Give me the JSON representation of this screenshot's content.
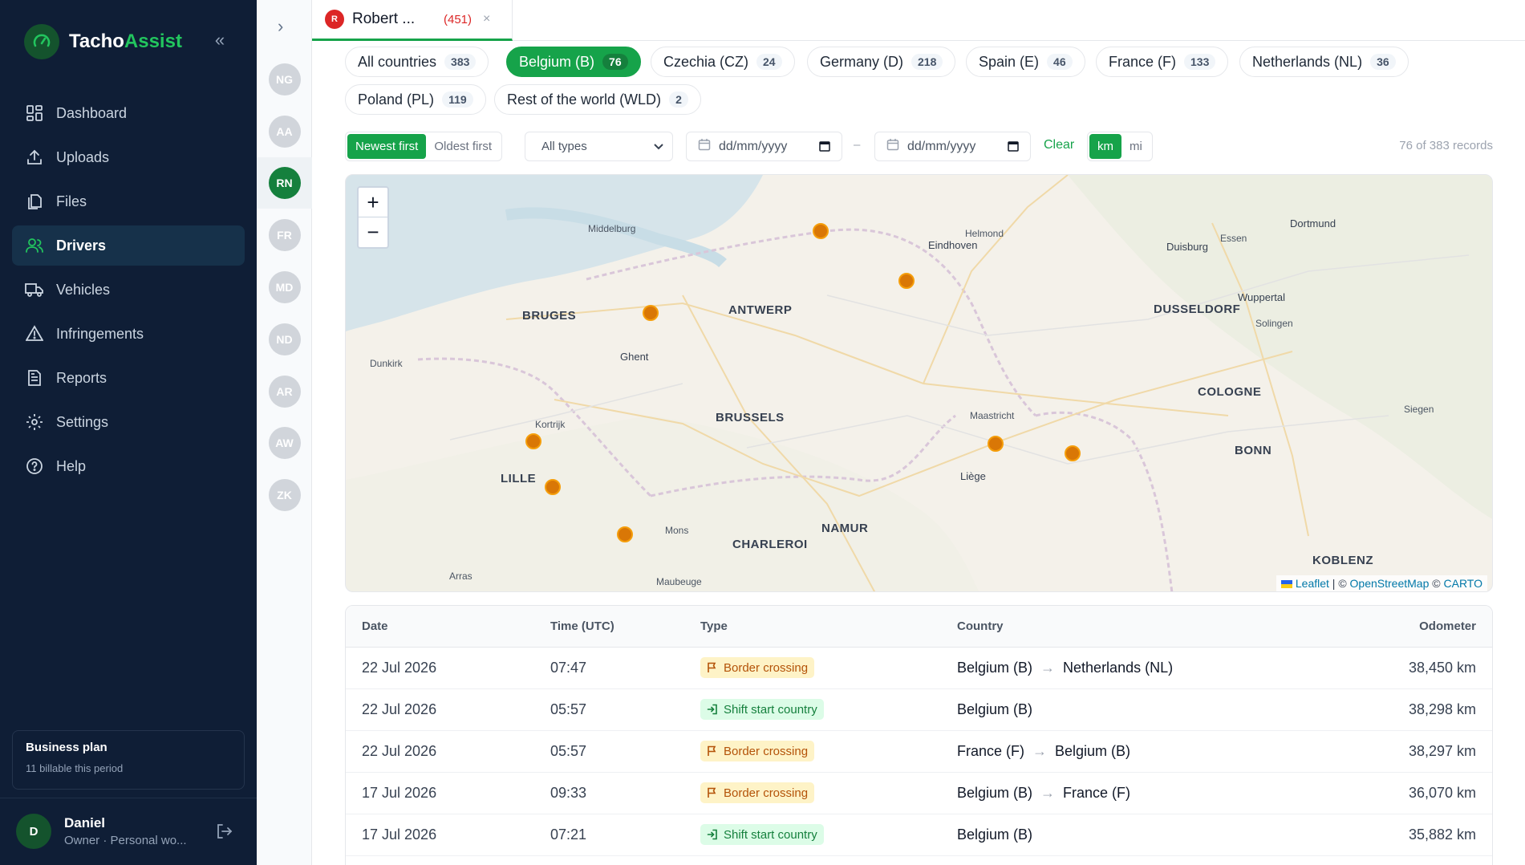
{
  "brand": {
    "name_prefix": "Tacho",
    "name_accent": "Assist"
  },
  "sidebar": {
    "items": [
      {
        "label": "Dashboard",
        "icon": "grid-icon"
      },
      {
        "label": "Uploads",
        "icon": "upload-icon"
      },
      {
        "label": "Files",
        "icon": "files-icon"
      },
      {
        "label": "Drivers",
        "icon": "users-icon",
        "active": true
      },
      {
        "label": "Vehicles",
        "icon": "truck-icon"
      },
      {
        "label": "Infringements",
        "icon": "warning-icon"
      },
      {
        "label": "Reports",
        "icon": "report-icon"
      },
      {
        "label": "Settings",
        "icon": "gear-icon"
      },
      {
        "label": "Help",
        "icon": "help-icon"
      }
    ],
    "plan": {
      "title": "Business plan",
      "subtitle": "11 billable this period"
    },
    "user": {
      "initial": "D",
      "name": "Daniel",
      "role": "Owner · Personal wo..."
    }
  },
  "rail": {
    "drivers": [
      "NG",
      "AA",
      "RN",
      "FR",
      "MD",
      "ND",
      "AR",
      "AW",
      "ZK"
    ],
    "active": "RN"
  },
  "tab": {
    "initial": "R",
    "name": "Robert ...",
    "count": "(451)",
    "close": "×"
  },
  "countries": [
    {
      "label": "All countries",
      "count": "383"
    },
    {
      "label": "Belgium (B)",
      "count": "76",
      "active": true
    },
    {
      "label": "Czechia (CZ)",
      "count": "24"
    },
    {
      "label": "Germany (D)",
      "count": "218"
    },
    {
      "label": "Spain (E)",
      "count": "46"
    },
    {
      "label": "France (F)",
      "count": "133"
    },
    {
      "label": "Netherlands (NL)",
      "count": "36"
    },
    {
      "label": "Poland (PL)",
      "count": "119"
    },
    {
      "label": "Rest of the world (WLD)",
      "count": "2"
    }
  ],
  "filters": {
    "sort_newest": "Newest first",
    "sort_oldest": "Oldest first",
    "type_select": "All types",
    "date_from": "dd/mm/yyyy",
    "date_to": "dd/mm/yyyy",
    "dash": "–",
    "clear": "Clear",
    "unit_km": "km",
    "unit_mi": "mi",
    "records": "76 of 383 records"
  },
  "map": {
    "zoom_in": "+",
    "zoom_out": "−",
    "cities": [
      "Middelburg",
      "BRUGES",
      "ANTWERP",
      "Ghent",
      "Dunkirk",
      "Kortrijk",
      "LILLE",
      "BRUSSELS",
      "Mons",
      "CHARLEROI",
      "NAMUR",
      "Arras",
      "Maubeuge",
      "Helmond",
      "Eindhoven",
      "Duisburg",
      "Essen",
      "Dortmund",
      "Wuppertal",
      "DUSSELDORF",
      "Solingen",
      "COLOGNE",
      "Maastricht",
      "Liège",
      "BONN",
      "Siegen",
      "KOBLENZ"
    ],
    "attribution": {
      "leaflet": "Leaflet",
      "sep1": " | © ",
      "osm": "OpenStreetMap",
      "sep2": " © ",
      "carto": "CARTO"
    }
  },
  "table": {
    "headers": {
      "date": "Date",
      "time": "Time (UTC)",
      "type": "Type",
      "country": "Country",
      "odometer": "Odometer"
    },
    "rows": [
      {
        "date": "22 Jul 2026",
        "time": "07:47",
        "type": "Border crossing",
        "kind": "border",
        "from": "Belgium (B)",
        "to": "Netherlands (NL)",
        "odometer": "38,450 km"
      },
      {
        "date": "22 Jul 2026",
        "time": "05:57",
        "type": "Shift start country",
        "kind": "shift",
        "from": "Belgium (B)",
        "to": "",
        "odometer": "38,298 km"
      },
      {
        "date": "22 Jul 2026",
        "time": "05:57",
        "type": "Border crossing",
        "kind": "border",
        "from": "France (F)",
        "to": "Belgium (B)",
        "odometer": "38,297 km"
      },
      {
        "date": "17 Jul 2026",
        "time": "09:33",
        "type": "Border crossing",
        "kind": "border",
        "from": "Belgium (B)",
        "to": "France (F)",
        "odometer": "36,070 km"
      },
      {
        "date": "17 Jul 2026",
        "time": "07:21",
        "type": "Shift start country",
        "kind": "shift",
        "from": "Belgium (B)",
        "to": "",
        "odometer": "35,882 km"
      }
    ]
  },
  "colors": {
    "accent": "#16a34a",
    "sidebar_bg": "#0f1e36",
    "marker": "#d97706"
  }
}
